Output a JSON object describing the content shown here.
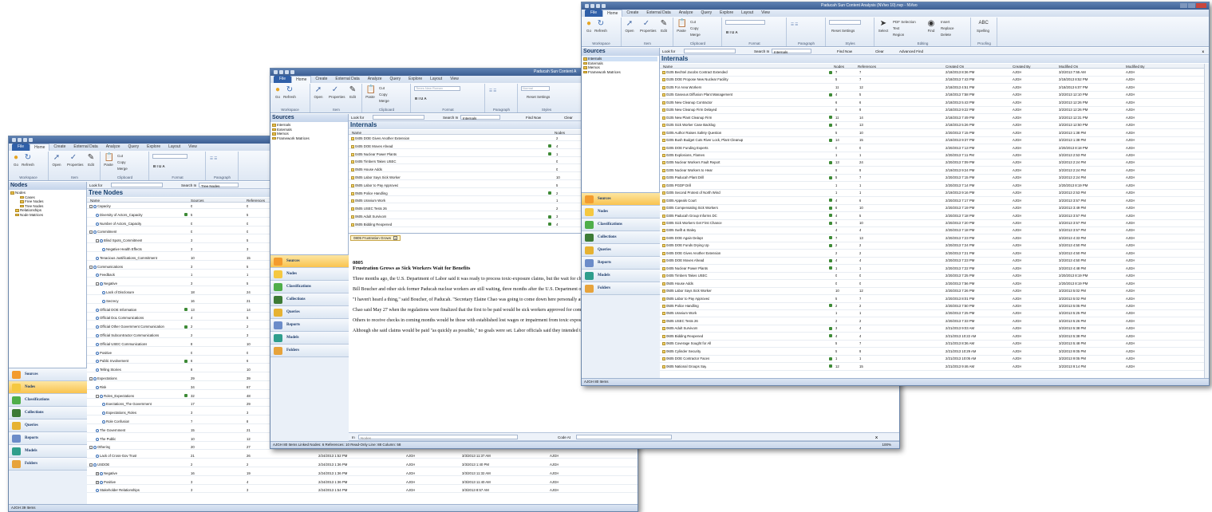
{
  "app": {
    "ribbon_tabs": [
      "File",
      "Home",
      "Create",
      "External Data",
      "Analyze",
      "Query",
      "Explore",
      "Layout",
      "View"
    ],
    "groups": [
      "Workspace",
      "Item",
      "Clipboard",
      "Format",
      "Paragraph",
      "Styles",
      "Editing",
      "Proofing"
    ],
    "buttons": {
      "go": "Go",
      "refresh": "Refresh",
      "open": "Open",
      "properties": "Properties",
      "edit": "Edit",
      "paste": "Paste",
      "cut": "Cut",
      "copy": "Copy",
      "merge": "Merge",
      "reset_settings": "Reset Settings",
      "select": "Select",
      "find": "Find",
      "pdf_selection": "PDF Selection",
      "text": "Text",
      "region": "Region",
      "insert": "Insert",
      "replace": "Replace",
      "delete": "Delete",
      "spelling": "Spelling",
      "font_placeholder": "Times New Roman",
      "style_value": "Normal"
    },
    "nav_buttons": [
      "Sources",
      "Nodes",
      "Classifications",
      "Collections",
      "Queries",
      "Reports",
      "Models",
      "Folders"
    ],
    "find": {
      "look_for": "Look for",
      "search_in": "Search In",
      "find_now": "Find Now",
      "clear": "Clear",
      "advanced_find": "Advanced Find",
      "close": "x"
    }
  },
  "win1": {
    "nav_title": "Nodes",
    "tree": [
      "Nodes",
      "Cases",
      "Free Nodes",
      "Tree Nodes",
      "Relationships",
      "Node Matrices"
    ],
    "search_in_value": "Tree Nodes",
    "list_title": "Tree Nodes",
    "cols": [
      "Name",
      "Sources",
      "References",
      "Created On",
      "Created By",
      "Modified On",
      "Modified By"
    ],
    "rows": [
      {
        "n": "Capacity",
        "s": "0",
        "r": "0",
        "lvl": 0,
        "pm": "-"
      },
      {
        "n": "Diversity of Actors_Capacity",
        "s": "5",
        "r": "5",
        "lvl": 1,
        "c": true
      },
      {
        "n": "Number of Actors_Capacity",
        "s": "0",
        "r": "0",
        "lvl": 1
      },
      {
        "n": "Commitment",
        "s": "0",
        "r": "0",
        "lvl": 0,
        "pm": "-"
      },
      {
        "n": "Blind Spots_Commitment",
        "s": "3",
        "r": "5",
        "lvl": 1,
        "pm": "-"
      },
      {
        "n": "Negative Health Effects",
        "s": "3",
        "r": "3",
        "lvl": 2
      },
      {
        "n": "Tenacious Justifications_Commitment",
        "s": "10",
        "r": "15",
        "lvl": 1
      },
      {
        "n": "Communications",
        "s": "3",
        "r": "5",
        "lvl": 0,
        "pm": "-"
      },
      {
        "n": "Feedback",
        "s": "1",
        "r": "1",
        "lvl": 1
      },
      {
        "n": "Negative",
        "s": "3",
        "r": "5",
        "lvl": 1,
        "pm": "-"
      },
      {
        "n": "Lack of Disclosure",
        "s": "18",
        "r": "24",
        "lvl": 2
      },
      {
        "n": "Secrecy",
        "s": "16",
        "r": "21",
        "lvl": 2
      },
      {
        "n": "Official DOE Information",
        "s": "13",
        "r": "14",
        "lvl": 1,
        "c": true
      },
      {
        "n": "Official DoL Communications",
        "s": "4",
        "r": "5",
        "lvl": 1
      },
      {
        "n": "Official Other Government Communication",
        "s": "2",
        "r": "2",
        "lvl": 1,
        "c": true
      },
      {
        "n": "Official Subcontractor Communications",
        "s": "2",
        "r": "3",
        "lvl": 1
      },
      {
        "n": "Official USEC Communications",
        "s": "8",
        "r": "10",
        "lvl": 1
      },
      {
        "n": "Positive",
        "s": "0",
        "r": "0",
        "lvl": 1
      },
      {
        "n": "Public Involvement",
        "s": "6",
        "r": "6",
        "lvl": 1,
        "c": true
      },
      {
        "n": "Telling Stories",
        "s": "8",
        "r": "10",
        "lvl": 1
      },
      {
        "n": "Expectations",
        "s": "29",
        "r": "39",
        "lvl": 0,
        "pm": "-"
      },
      {
        "n": "Risk",
        "s": "34",
        "r": "67",
        "lvl": 1
      },
      {
        "n": "Roles_Expectations",
        "s": "32",
        "r": "48",
        "lvl": 1,
        "pm": "-",
        "c": true
      },
      {
        "n": "Exectations_The Government",
        "s": "17",
        "r": "29",
        "lvl": 2
      },
      {
        "n": "Expectations_Roles",
        "s": "3",
        "r": "3",
        "lvl": 2
      },
      {
        "n": "Role Confusion",
        "s": "7",
        "r": "8",
        "lvl": 2
      },
      {
        "n": "The Government",
        "s": "15",
        "r": "21",
        "lvl": 1
      },
      {
        "n": "The Public",
        "s": "10",
        "r": "12",
        "lvl": 1
      },
      {
        "n": "Othering",
        "s": "20",
        "r": "27",
        "lvl": 0,
        "pm": "-",
        "co": "2/24/2013 1:35 PM",
        "cb": "AJGH",
        "mo": "3/3/2013 11:37 AM",
        "mb": "AJGH"
      },
      {
        "n": "Lack of Cross-Gov Trust",
        "s": "21",
        "r": "26",
        "lvl": 1,
        "co": "2/24/2013 1:52 PM",
        "cb": "AJGH",
        "mo": "3/3/2013 11:37 AM",
        "mb": "AJGH"
      },
      {
        "n": "USDOE",
        "s": "2",
        "r": "2",
        "lvl": 0,
        "pm": "-",
        "co": "2/24/2013 1:36 PM",
        "cb": "AJGH",
        "mo": "3/3/2013 1:40 PM",
        "mb": "AJGH"
      },
      {
        "n": "Negative",
        "s": "16",
        "r": "19",
        "lvl": 1,
        "pm": "+",
        "co": "2/24/2013 1:36 PM",
        "cb": "AJGH",
        "mo": "3/3/2013 11:32 AM",
        "mb": "AJGH"
      },
      {
        "n": "Positive",
        "s": "3",
        "r": "4",
        "lvl": 1,
        "pm": "+",
        "co": "2/24/2013 1:36 PM",
        "cb": "AJGH",
        "mo": "3/3/2013 11:40 AM",
        "mb": "AJGH"
      },
      {
        "n": "Stakeholder Relationships",
        "s": "3",
        "r": "3",
        "lvl": 1,
        "co": "2/24/2013 1:54 PM",
        "cb": "AJGH",
        "mo": "3/3/2013 8:57 AM",
        "mb": "AJGH"
      }
    ],
    "status": "AJGH  39 Items"
  },
  "win2": {
    "title": "Paducah Sun Content A",
    "nav_title": "Sources",
    "tree": [
      "Internals",
      "Externals",
      "Memos",
      "Framework Matrices"
    ],
    "search_in_value": "Internals",
    "list_title": "Internals",
    "cols": [
      "Name",
      "Nodes"
    ],
    "rows": [
      {
        "n": "0405 DOE Gives Another Extension",
        "v": "2"
      },
      {
        "n": "0405 DOE Moves Ahead",
        "v": "4",
        "c": true
      },
      {
        "n": "0405 Nuclear Power Plants",
        "v": "1",
        "c": true
      },
      {
        "n": "0405 Timbers Takes USEC",
        "v": "0"
      },
      {
        "n": "0505 House Adds",
        "v": "0"
      },
      {
        "n": "0505 Labor Says Sick Worker",
        "v": "10"
      },
      {
        "n": "0505 Labor to Pay Approved",
        "v": "5"
      },
      {
        "n": "0505 Police Handling",
        "v": "2",
        "c": true
      },
      {
        "n": "0505 Uranium Work",
        "v": "1"
      },
      {
        "n": "0505 USEC Tests 26",
        "v": "2"
      },
      {
        "n": "0605 Adult Survivors",
        "v": "3",
        "c": true
      },
      {
        "n": "0605 Bidding Reopened",
        "v": "4",
        "c": true
      }
    ],
    "doc_tab": "0805 Frustration Grows",
    "doc": {
      "heading": "0805",
      "title": "Frustration Grows as Sick Workers Wait for Benefits",
      "paragraphs": [
        "Three months ago, the U.S. Department of Labor said it was ready to process toxic-exposure claims, but the wait for checks continues.",
        "Bill Boucher and other sick former Paducah nuclear workers are still waiting, three months after the U.S. Department of Labor announced it was ready to start processing toxic exposure claims.",
        "\"I haven't heard a thing,\" said Boucher, of Paducah. \"Secretary Elaine Chao was going to come down here personally and hand out some checks.\"",
        "Chao said May 27 when the regulations were finalized that the first to be paid would be sick workers approved for compensation before Congress transferred the heavily backlogged program last fall from the Department of Energy to the Department of Labor.",
        "Others to receive checks in coming months would be those with established lost wages or impairment from toxic exposure, and people with the clearest links between illness and exposure, Chao said.",
        "Although she said claims would be paid \"as quickly as possible,\" no goals were set. Labor officials said they intended to issue at least 1,200 checks nationally by Oct. 1, the start of a new fiscal year."
      ]
    },
    "bottom": {
      "in_label": "In",
      "in_value": "Nodes",
      "code_at": "Code At",
      "close": "X",
      "zoom": "100%"
    },
    "status": "AJGH  80 Items   Linked   Nodes: 6  References: 10   Read-Only  Line: 88  Column: 58"
  },
  "win3": {
    "title": "Paducah Sun Content Analysis (NVivo 10).nvp - NVivo",
    "nav_title": "Sources",
    "tree": [
      "Internals",
      "Externals",
      "Memos",
      "Framework Matrices"
    ],
    "search_in_value": "Internals",
    "list_title": "Internals",
    "cols": [
      "Name",
      "Nodes",
      "References",
      "Created On",
      "Created By",
      "Modified On",
      "Modified By"
    ],
    "rows": [
      {
        "n": "0105 Bechtel Jacobs Contract Extended",
        "v": "7",
        "r": "7",
        "co": "2/18/2013 8:36 PM",
        "cb": "AJGH",
        "mo": "3/2/2013 7:55 AM",
        "mb": "AJGH",
        "c": true
      },
      {
        "n": "0105 DOE Propose New Nuclear Facility",
        "v": "5",
        "r": "7",
        "co": "2/18/2013 7:43 PM",
        "cb": "AJGH",
        "mo": "2/18/2013 8:52 PM",
        "mb": "AJGH"
      },
      {
        "n": "0105 For Area Workers",
        "v": "11",
        "r": "12",
        "co": "2/18/2013 4:51 PM",
        "cb": "AJGH",
        "mo": "2/18/2013 6:07 PM",
        "mb": "AJGH"
      },
      {
        "n": "0105 Gaseous Diffusion Plant Management",
        "v": "4",
        "r": "5",
        "co": "2/18/2013 7:58 PM",
        "cb": "AJGH",
        "mo": "3/2/2013 12:10 PM",
        "mb": "AJGH",
        "c": true
      },
      {
        "n": "0105 New Cleanup Contractor",
        "v": "6",
        "r": "6",
        "co": "2/18/2013 5:43 PM",
        "cb": "AJGH",
        "mo": "3/2/2013 12:26 PM",
        "mb": "AJGH"
      },
      {
        "n": "0105 New Cleanup Firm Delayed",
        "v": "6",
        "r": "9",
        "co": "2/18/2013 9:22 PM",
        "cb": "AJGH",
        "mo": "3/2/2013 12:26 PM",
        "mb": "AJGH"
      },
      {
        "n": "0105 New Plant Cleanup Firm",
        "v": "11",
        "r": "14",
        "co": "2/18/2013 7:49 PM",
        "cb": "AJGH",
        "mo": "3/2/2013 12:31 PM",
        "mb": "AJGH",
        "c": true
      },
      {
        "n": "0105 Sick Worker Case Backlog",
        "v": "9",
        "r": "13",
        "co": "2/18/2013 5:26 PM",
        "cb": "AJGH",
        "mo": "3/2/2013 12:50 PM",
        "mb": "AJGH",
        "c": true
      },
      {
        "n": "0205 Author Raises Safety Question",
        "v": "5",
        "r": "10",
        "co": "2/20/2013 7:15 PM",
        "cb": "AJGH",
        "mo": "3/2/2013 1:38 PM",
        "mb": "AJGH"
      },
      {
        "n": "0205 Bush Budget Cuts River Lock, Plant Cleanup",
        "v": "14",
        "r": "15",
        "co": "2/19/2013 9:37 PM",
        "cb": "AJGH",
        "mo": "3/2/2013 1:38 PM",
        "mb": "AJGH",
        "c": true
      },
      {
        "n": "0205 DOE Funding Experts",
        "v": "0",
        "r": "0",
        "co": "2/20/2013 7:13 PM",
        "cb": "AJGH",
        "mo": "2/20/2013 8:18 PM",
        "mb": "AJGH"
      },
      {
        "n": "0205 Explosions, Flames",
        "v": "1",
        "r": "1",
        "co": "2/20/2013 7:11 PM",
        "cb": "AJGH",
        "mo": "3/2/2013 2:53 PM",
        "mb": "AJGH"
      },
      {
        "n": "0205 Nuclear Workers Fault Report",
        "v": "13",
        "r": "24",
        "co": "2/20/2013 7:09 PM",
        "cb": "AJGH",
        "mo": "3/2/2013 2:24 PM",
        "mb": "AJGH",
        "c": true
      },
      {
        "n": "0205 Nuclear Workers to Hear",
        "v": "9",
        "r": "9",
        "co": "2/19/2013 9:24 PM",
        "cb": "AJGH",
        "mo": "3/2/2013 2:24 PM",
        "mb": "AJGH"
      },
      {
        "n": "0205 Paducah Plant Drill",
        "v": "5",
        "r": "7",
        "co": "2/20/2013 7:15 PM",
        "cb": "AJGH",
        "mo": "3/2/2013 2:24 PM",
        "mb": "AJGH",
        "c": true
      },
      {
        "n": "0205 PGDP Drill",
        "v": "1",
        "r": "1",
        "co": "2/20/2013 7:14 PM",
        "cb": "AJGH",
        "mo": "2/20/2013 8:19 PM",
        "mb": "AJGH"
      },
      {
        "n": "0205 Second Protest of North Wind",
        "v": "1",
        "r": "1",
        "co": "2/19/2013 9:16 PM",
        "cb": "AJGH",
        "mo": "3/2/2013 2:53 PM",
        "mb": "AJGH"
      },
      {
        "n": "0305 Appeals Court",
        "v": "4",
        "r": "6",
        "co": "2/20/2013 7:17 PM",
        "cb": "AJGH",
        "mo": "3/2/2013 3:57 PM",
        "mb": "AJGH",
        "c": true
      },
      {
        "n": "0305 Compensating Sick Workers",
        "v": "6",
        "r": "10",
        "co": "2/20/2013 7:19 PM",
        "cb": "AJGH",
        "mo": "3/2/2013 3:49 PM",
        "mb": "AJGH",
        "c": true
      },
      {
        "n": "0305 Paducah Group Informs DC",
        "v": "4",
        "r": "5",
        "co": "2/20/2013 7:18 PM",
        "cb": "AJGH",
        "mo": "3/2/2013 3:57 PM",
        "mb": "AJGH",
        "c": true
      },
      {
        "n": "0305 Sick Workers Get First Chance",
        "v": "9",
        "r": "10",
        "co": "2/20/2013 7:20 PM",
        "cb": "AJGH",
        "mo": "3/2/2013 3:57 PM",
        "mb": "AJGH",
        "c": true
      },
      {
        "n": "0305 Swift & Staley",
        "v": "4",
        "r": "4",
        "co": "2/20/2013 7:18 PM",
        "cb": "AJGH",
        "mo": "3/2/2013 3:57 PM",
        "mb": "AJGH"
      },
      {
        "n": "0405 DOE Again Delays",
        "v": "7",
        "r": "13",
        "co": "2/20/2013 7:23 PM",
        "cb": "AJGH",
        "mo": "3/2/2013 4:33 PM",
        "mb": "AJGH",
        "c": true
      },
      {
        "n": "0405 DOE Funds Drying Up",
        "v": "2",
        "r": "2",
        "co": "2/20/2013 7:24 PM",
        "cb": "AJGH",
        "mo": "3/2/2013 4:50 PM",
        "mb": "AJGH",
        "c": true
      },
      {
        "n": "0405 DOE Gives Another Extension",
        "v": "2",
        "r": "2",
        "co": "2/20/2013 7:21 PM",
        "cb": "AJGH",
        "mo": "3/2/2013 4:50 PM",
        "mb": "AJGH"
      },
      {
        "n": "0405 DOE Moves Ahead",
        "v": "4",
        "r": "4",
        "co": "2/20/2013 7:23 PM",
        "cb": "AJGH",
        "mo": "3/2/2013 4:50 PM",
        "mb": "AJGH",
        "c": true
      },
      {
        "n": "0405 Nuclear Power Plants",
        "v": "1",
        "r": "1",
        "co": "2/20/2013 7:22 PM",
        "cb": "AJGH",
        "mo": "3/2/2013 4:48 PM",
        "mb": "AJGH",
        "c": true
      },
      {
        "n": "0405 Timbers Takes USEC",
        "v": "0",
        "r": "0",
        "co": "2/20/2013 7:25 PM",
        "cb": "AJGH",
        "mo": "2/20/2013 8:19 PM",
        "mb": "AJGH"
      },
      {
        "n": "0505 House Adds",
        "v": "0",
        "r": "0",
        "co": "2/20/2013 7:56 PM",
        "cb": "AJGH",
        "mo": "2/20/2013 8:19 PM",
        "mb": "AJGH"
      },
      {
        "n": "0505 Labor Says Sick Worker",
        "v": "10",
        "r": "12",
        "co": "2/20/2013 7:26 PM",
        "cb": "AJGH",
        "mo": "3/2/2013 5:02 PM",
        "mb": "AJGH"
      },
      {
        "n": "0505 Labor to Pay Approved",
        "v": "5",
        "r": "7",
        "co": "2/20/2013 8:01 PM",
        "cb": "AJGH",
        "mo": "3/2/2013 5:02 PM",
        "mb": "AJGH"
      },
      {
        "n": "0505 Police Handling",
        "v": "2",
        "r": "2",
        "co": "2/20/2013 7:50 PM",
        "cb": "AJGH",
        "mo": "3/2/2013 5:05 PM",
        "mb": "AJGH",
        "c": true
      },
      {
        "n": "0505 Uranium Work",
        "v": "1",
        "r": "1",
        "co": "2/20/2013 7:25 PM",
        "cb": "AJGH",
        "mo": "3/2/2013 5:25 PM",
        "mb": "AJGH"
      },
      {
        "n": "0505 USEC Tests 26",
        "v": "2",
        "r": "2",
        "co": "2/20/2013 7:33 PM",
        "cb": "AJGH",
        "mo": "3/2/2013 5:26 PM",
        "mb": "AJGH"
      },
      {
        "n": "0605 Adult Survivors",
        "v": "3",
        "r": "4",
        "co": "2/21/2013 9:03 AM",
        "cb": "AJGH",
        "mo": "3/2/2013 5:38 PM",
        "mb": "AJGH",
        "c": true
      },
      {
        "n": "0605 Bidding Reopened",
        "v": "4",
        "r": "4",
        "co": "2/21/2013 10:22 AM",
        "cb": "AJGH",
        "mo": "3/2/2013 5:38 PM",
        "mb": "AJGH",
        "c": true
      },
      {
        "n": "0605 Coverage Sought for All",
        "v": "5",
        "r": "7",
        "co": "2/21/2013 8:36 AM",
        "cb": "AJGH",
        "mo": "3/2/2013 5:48 PM",
        "mb": "AJGH"
      },
      {
        "n": "0605 Cylinder Security",
        "v": "5",
        "r": "9",
        "co": "2/21/2013 10:29 AM",
        "cb": "AJGH",
        "mo": "3/2/2013 9:05 PM",
        "mb": "AJGH"
      },
      {
        "n": "0605 DOE Contractor Faces",
        "v": "1",
        "r": "1",
        "co": "2/21/2013 10:05 AM",
        "cb": "AJGH",
        "mo": "3/2/2013 9:05 PM",
        "mb": "AJGH",
        "c": true
      },
      {
        "n": "0605 National Groups Say",
        "v": "12",
        "r": "15",
        "co": "2/21/2013 9:46 AM",
        "cb": "AJGH",
        "mo": "3/2/2013 9:14 PM",
        "mb": "AJGH",
        "c": true
      }
    ],
    "status": "AJGH  80 Items"
  }
}
